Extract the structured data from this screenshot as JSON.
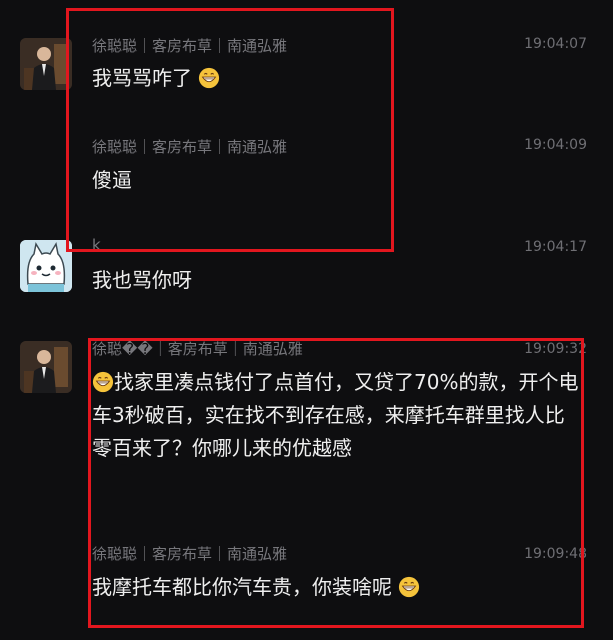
{
  "messages": [
    {
      "meta": "徐聪聪｜客房布草｜南通弘雅",
      "time": "19:04:07",
      "text": "我骂骂咋了"
    },
    {
      "meta": "徐聪聪｜客房布草｜南通弘雅",
      "time": "19:04:09",
      "text": "傻逼"
    },
    {
      "meta": "k",
      "time": "19:04:17",
      "text": "我也骂你呀"
    },
    {
      "meta": "徐聪��｜客房布草｜南通弘雅",
      "time": "19:09:32",
      "text": "找家里凑点钱付了点首付，又贷了70%的款，开个电车3秒破百，实在找不到存在感，来摩托车群里找人比零百来了？你哪儿来的优越感"
    },
    {
      "meta": "徐聪聪｜客房布草｜南通弘雅",
      "time": "19:09:48",
      "text": "我摩托车都比你汽车贵，你装啥呢"
    }
  ],
  "icons": {
    "emoji": "grinning-face-icon",
    "avatar_user": "man-in-suit-avatar",
    "avatar_other": "cartoon-cat-avatar"
  },
  "colors": {
    "background": "#0e0e10",
    "highlight_box": "#e2161e"
  }
}
